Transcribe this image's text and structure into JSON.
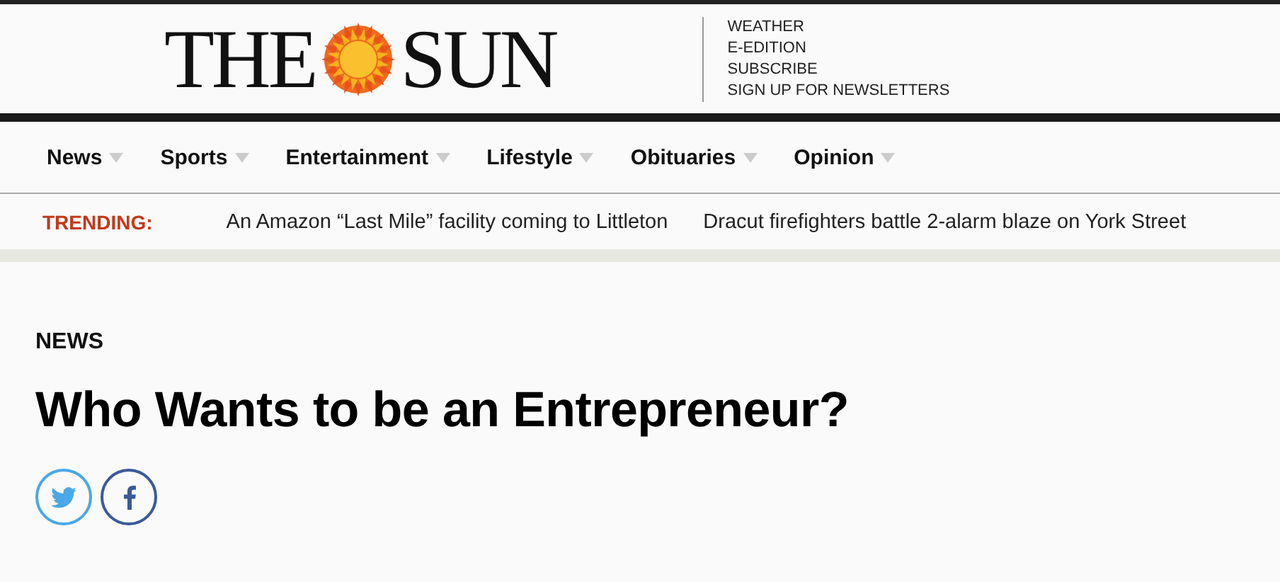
{
  "masthead": {
    "logo_left": "THE",
    "logo_right": "SUN",
    "links": [
      "WEATHER",
      "E-EDITION",
      "SUBSCRIBE",
      "SIGN UP FOR NEWSLETTERS"
    ]
  },
  "nav": {
    "items": [
      {
        "label": "News"
      },
      {
        "label": "Sports"
      },
      {
        "label": "Entertainment"
      },
      {
        "label": "Lifestyle"
      },
      {
        "label": "Obituaries"
      },
      {
        "label": "Opinion"
      }
    ]
  },
  "trending": {
    "label": "TRENDING:",
    "items": [
      "An Amazon “Last Mile” facility coming to Littleton",
      "Dracut firefighters battle 2-alarm blaze on York Street"
    ]
  },
  "article": {
    "section": "NEWS",
    "headline": "Who Wants to be an Entrepreneur?",
    "share": [
      {
        "kind": "twitter"
      },
      {
        "kind": "facebook"
      }
    ]
  }
}
